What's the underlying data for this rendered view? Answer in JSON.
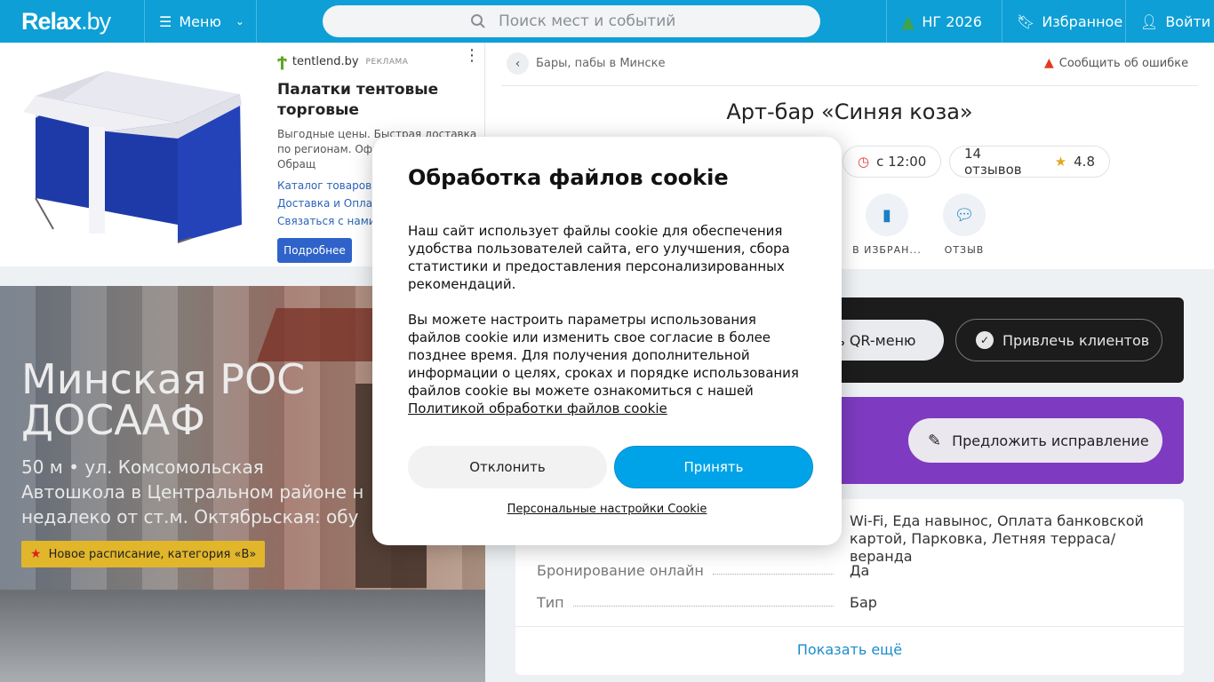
{
  "header": {
    "logo_main": "Relax",
    "logo_suffix": ".by",
    "menu_label": "Меню",
    "search_placeholder": "Поиск мест и событий",
    "ng_label": "НГ 2026",
    "favorites_label": "Избранное",
    "login_label": "Войти"
  },
  "ad": {
    "brand": "tentlend.by",
    "tag": "РЕКЛАМА",
    "title": "Палатки тентовые торговые",
    "description": "Выгодные цены. Быстрая доставка по регионам. Офи гарантия. Обращ",
    "links": [
      "Каталог товаров",
      "Доставка и Оплат",
      "Связаться с нами"
    ],
    "button": "Подробнее"
  },
  "promo": {
    "title": "Минская РОС ДОСААФ",
    "subtitle_line1": "50 м • ул. Комсомольская",
    "subtitle_line2": "Автошкола в Центральном районе н",
    "subtitle_line3": "недалеко от ст.м. Октябрьская: обу",
    "badge": "Новое расписание, категория «В»"
  },
  "venue": {
    "breadcrumb": "Бары, пабы в Минске",
    "report": "Сообщить об ошибке",
    "title": "Арт-бар «Синяя коза»",
    "open_time": "с 12:00",
    "reviews": "14 отзывов",
    "rating": "4.8",
    "actions": [
      {
        "label": "В ИЗБРАН..."
      },
      {
        "label": "ОТЗЫВ"
      }
    ],
    "qr_button": "ть QR-меню",
    "clients_button": "Привлечь клиентов",
    "suggest_button": "Предложить исправление",
    "info": {
      "features_value": "Wi-Fi, Еда навынос, Оплата банковской картой, Парковка, Летняя терраса/веранда",
      "booking_key": "Бронирование онлайн",
      "booking_value": "Да",
      "type_key": "Тип",
      "type_value": "Бар"
    },
    "show_more": "Показать ещё"
  },
  "cookie": {
    "title": "Обработка файлов cookie",
    "p1": "Наш сайт использует файлы cookie для обеспечения удобства пользователей сайта, его улучшения, сбора статистики и предоставления персонализированных рекомендаций.",
    "p2": "Вы можете настроить параметры использования файлов cookie или изменить свое согласие в более позднее время. Для получения дополнительной информации о целях, сроках и порядке использования файлов cookie вы можете ознакомиться с нашей",
    "policy_link": "Политикой обработки файлов cookie",
    "decline": "Отклонить",
    "accept": "Принять",
    "settings": "Персональные настройки Cookie"
  }
}
